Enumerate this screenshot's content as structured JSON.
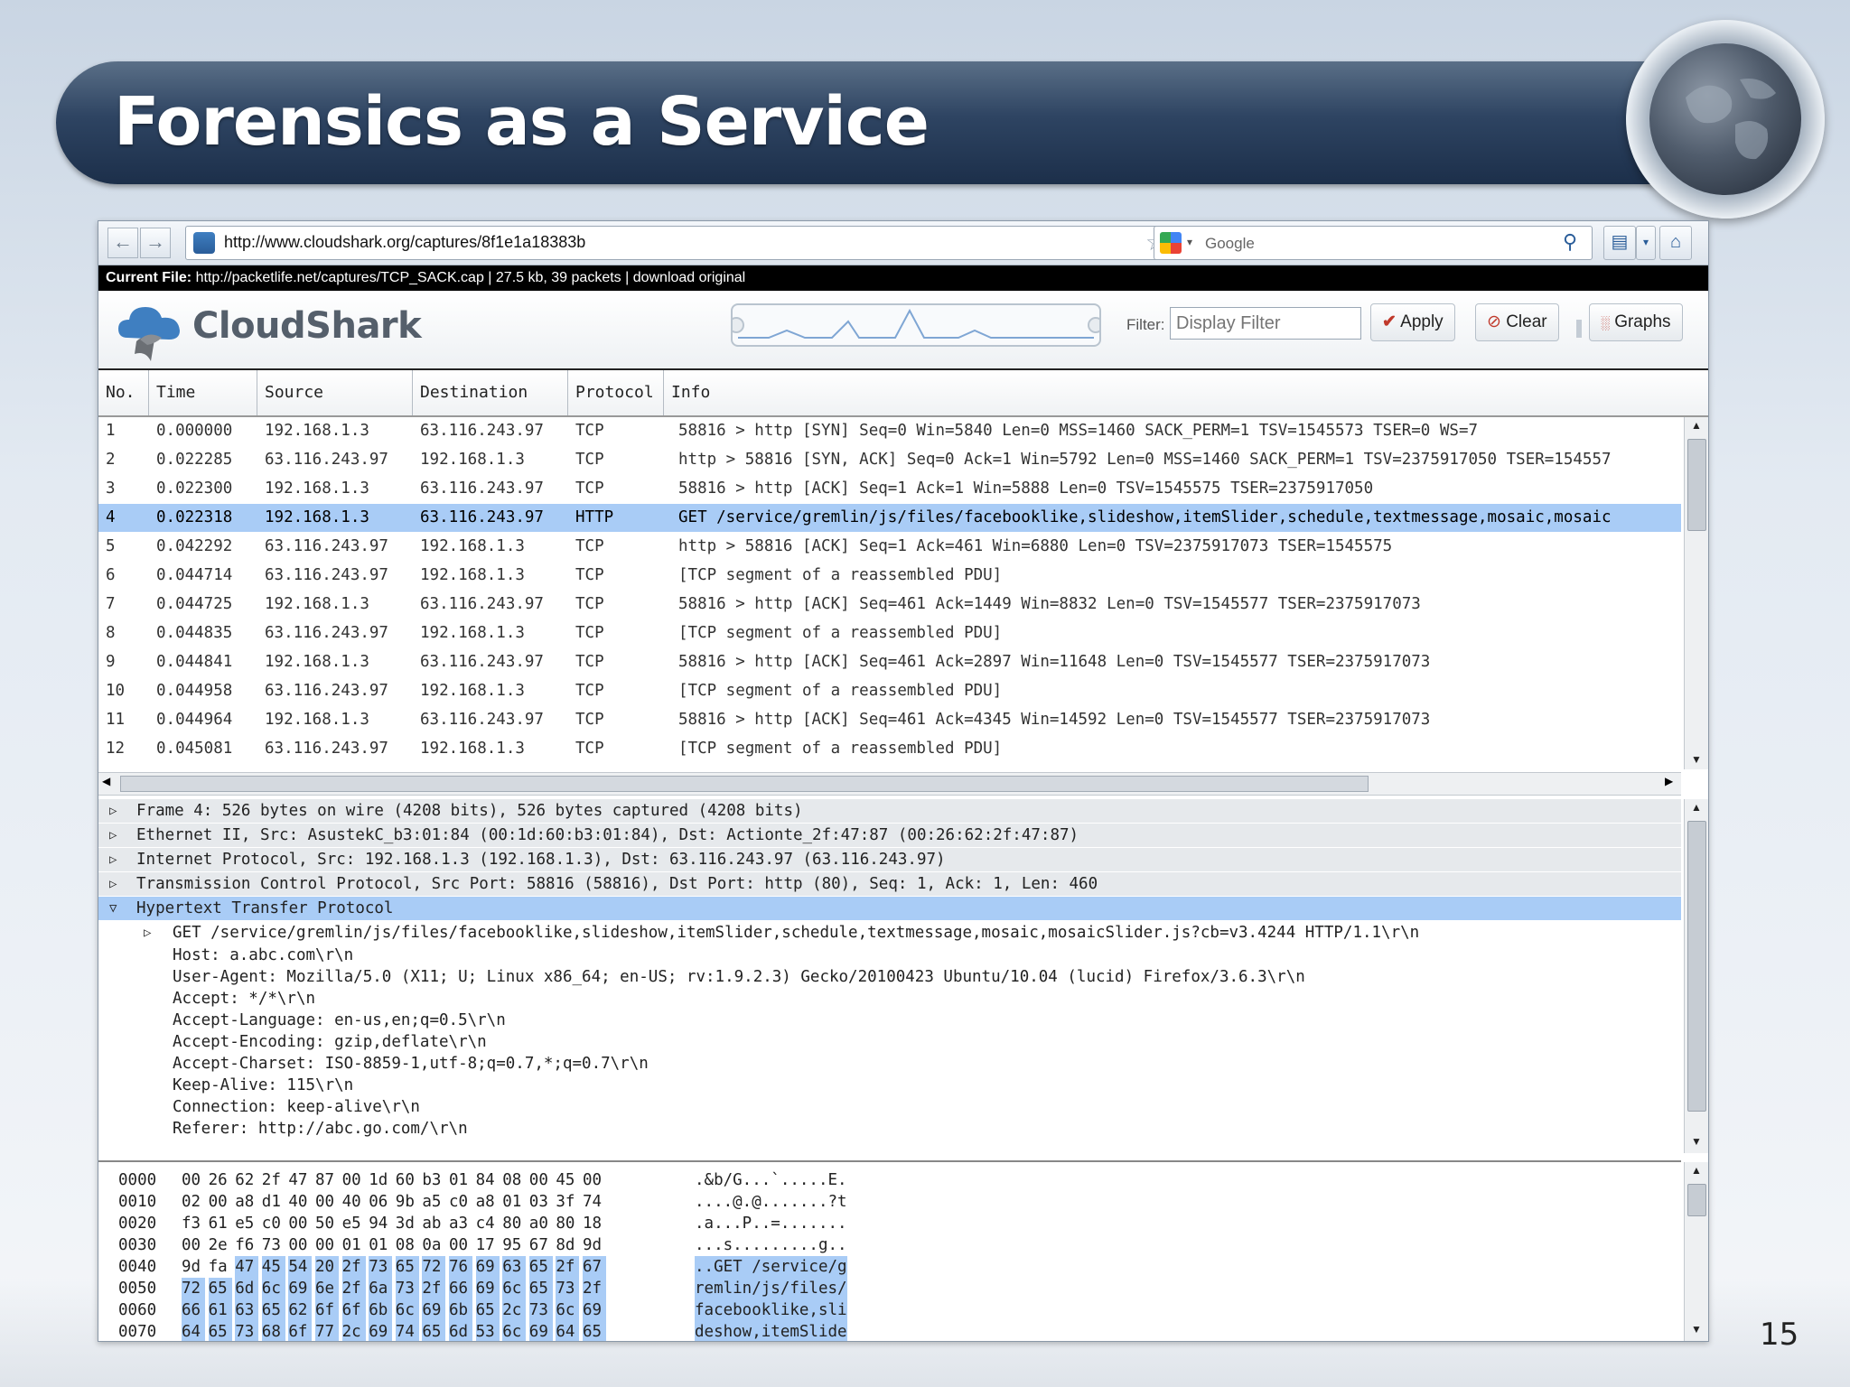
{
  "slide": {
    "title": "Forensics as a Service",
    "page_number": "15"
  },
  "browser": {
    "url": "http://www.cloudshark.org/captures/8f1e1a18383b",
    "search_placeholder": "Google",
    "current_file": {
      "label": "Current File:",
      "text": "http://packetlife.net/captures/TCP_SACK.cap | 27.5 kb, 39 packets | download original"
    }
  },
  "cloudshark": {
    "brand": "CloudShark",
    "filter_label": "Filter:",
    "filter_placeholder": "Display Filter",
    "apply_label": "Apply",
    "clear_label": "Clear",
    "graphs_label": "Graphs",
    "accent_color": "#3f7fc1",
    "selection_color": "#a9ccf6"
  },
  "packet_list": {
    "columns": [
      "No.",
      "Time",
      "Source",
      "Destination",
      "Protocol",
      "Info"
    ],
    "rows": [
      {
        "no": "1",
        "time": "0.000000",
        "src": "192.168.1.3",
        "dst": "63.116.243.97",
        "proto": "TCP",
        "info": "58816 > http [SYN] Seq=0 Win=5840 Len=0 MSS=1460 SACK_PERM=1 TSV=1545573 TSER=0 WS=7",
        "selected": false
      },
      {
        "no": "2",
        "time": "0.022285",
        "src": "63.116.243.97",
        "dst": "192.168.1.3",
        "proto": "TCP",
        "info": "http > 58816 [SYN, ACK] Seq=0 Ack=1 Win=5792 Len=0 MSS=1460 SACK_PERM=1 TSV=2375917050 TSER=154557",
        "selected": false
      },
      {
        "no": "3",
        "time": "0.022300",
        "src": "192.168.1.3",
        "dst": "63.116.243.97",
        "proto": "TCP",
        "info": "58816 > http [ACK] Seq=1 Ack=1 Win=5888 Len=0 TSV=1545575 TSER=2375917050",
        "selected": false
      },
      {
        "no": "4",
        "time": "0.022318",
        "src": "192.168.1.3",
        "dst": "63.116.243.97",
        "proto": "HTTP",
        "info": "GET /service/gremlin/js/files/facebooklike,slideshow,itemSlider,schedule,textmessage,mosaic,mosaic",
        "selected": true
      },
      {
        "no": "5",
        "time": "0.042292",
        "src": "63.116.243.97",
        "dst": "192.168.1.3",
        "proto": "TCP",
        "info": "http > 58816 [ACK] Seq=1 Ack=461 Win=6880 Len=0 TSV=2375917073 TSER=1545575",
        "selected": false
      },
      {
        "no": "6",
        "time": "0.044714",
        "src": "63.116.243.97",
        "dst": "192.168.1.3",
        "proto": "TCP",
        "info": "[TCP segment of a reassembled PDU]",
        "selected": false
      },
      {
        "no": "7",
        "time": "0.044725",
        "src": "192.168.1.3",
        "dst": "63.116.243.97",
        "proto": "TCP",
        "info": "58816 > http [ACK] Seq=461 Ack=1449 Win=8832 Len=0 TSV=1545577 TSER=2375917073",
        "selected": false
      },
      {
        "no": "8",
        "time": "0.044835",
        "src": "63.116.243.97",
        "dst": "192.168.1.3",
        "proto": "TCP",
        "info": "[TCP segment of a reassembled PDU]",
        "selected": false
      },
      {
        "no": "9",
        "time": "0.044841",
        "src": "192.168.1.3",
        "dst": "63.116.243.97",
        "proto": "TCP",
        "info": "58816 > http [ACK] Seq=461 Ack=2897 Win=11648 Len=0 TSV=1545577 TSER=2375917073",
        "selected": false
      },
      {
        "no": "10",
        "time": "0.044958",
        "src": "63.116.243.97",
        "dst": "192.168.1.3",
        "proto": "TCP",
        "info": "[TCP segment of a reassembled PDU]",
        "selected": false
      },
      {
        "no": "11",
        "time": "0.044964",
        "src": "192.168.1.3",
        "dst": "63.116.243.97",
        "proto": "TCP",
        "info": "58816 > http [ACK] Seq=461 Ack=4345 Win=14592 Len=0 TSV=1545577 TSER=2375917073",
        "selected": false
      },
      {
        "no": "12",
        "time": "0.045081",
        "src": "63.116.243.97",
        "dst": "192.168.1.3",
        "proto": "TCP",
        "info": "[TCP segment of a reassembled PDU]",
        "selected": false
      }
    ]
  },
  "details": [
    {
      "kind": "collapsed",
      "text": "Frame 4: 526 bytes on wire (4208 bits), 526 bytes captured (4208 bits)"
    },
    {
      "kind": "collapsed",
      "text": "Ethernet II, Src: AsustekC_b3:01:84 (00:1d:60:b3:01:84), Dst: Actionte_2f:47:87 (00:26:62:2f:47:87)"
    },
    {
      "kind": "collapsed",
      "text": "Internet Protocol, Src: 192.168.1.3 (192.168.1.3), Dst: 63.116.243.97 (63.116.243.97)"
    },
    {
      "kind": "collapsed",
      "text": "Transmission Control Protocol, Src Port: 58816 (58816), Dst Port: http (80), Seq: 1, Ack: 1, Len: 460"
    },
    {
      "kind": "expanded",
      "text": "Hypertext Transfer Protocol"
    },
    {
      "kind": "child-collapsed",
      "text": "GET /service/gremlin/js/files/facebooklike,slideshow,itemSlider,schedule,textmessage,mosaic,mosaicSlider.js?cb=v3.4244 HTTP/1.1\\r\\n"
    },
    {
      "kind": "child",
      "text": "Host: a.abc.com\\r\\n"
    },
    {
      "kind": "child",
      "text": "User-Agent: Mozilla/5.0 (X11; U; Linux x86_64; en-US; rv:1.9.2.3) Gecko/20100423 Ubuntu/10.04 (lucid) Firefox/3.6.3\\r\\n"
    },
    {
      "kind": "child",
      "text": "Accept: */*\\r\\n"
    },
    {
      "kind": "child",
      "text": "Accept-Language: en-us,en;q=0.5\\r\\n"
    },
    {
      "kind": "child",
      "text": "Accept-Encoding: gzip,deflate\\r\\n"
    },
    {
      "kind": "child",
      "text": "Accept-Charset: ISO-8859-1,utf-8;q=0.7,*;q=0.7\\r\\n"
    },
    {
      "kind": "child",
      "text": "Keep-Alive: 115\\r\\n"
    },
    {
      "kind": "child",
      "text": "Connection: keep-alive\\r\\n"
    },
    {
      "kind": "child",
      "text": "Referer: http://abc.go.com/\\r\\n"
    }
  ],
  "hex": [
    {
      "offset": "0000",
      "bytes": [
        "00",
        "26",
        "62",
        "2f",
        "47",
        "87",
        "00",
        "1d",
        "60",
        "b3",
        "01",
        "84",
        "08",
        "00",
        "45",
        "00"
      ],
      "sel_from": 16,
      "ascii": ".&b/G...`.....E.",
      "ascii_sel": false
    },
    {
      "offset": "0010",
      "bytes": [
        "02",
        "00",
        "a8",
        "d1",
        "40",
        "00",
        "40",
        "06",
        "9b",
        "a5",
        "c0",
        "a8",
        "01",
        "03",
        "3f",
        "74"
      ],
      "sel_from": 16,
      "ascii": "....@.@.......?t",
      "ascii_sel": false
    },
    {
      "offset": "0020",
      "bytes": [
        "f3",
        "61",
        "e5",
        "c0",
        "00",
        "50",
        "e5",
        "94",
        "3d",
        "ab",
        "a3",
        "c4",
        "80",
        "a0",
        "80",
        "18"
      ],
      "sel_from": 16,
      "ascii": ".a...P..=.......",
      "ascii_sel": false
    },
    {
      "offset": "0030",
      "bytes": [
        "00",
        "2e",
        "f6",
        "73",
        "00",
        "00",
        "01",
        "01",
        "08",
        "0a",
        "00",
        "17",
        "95",
        "67",
        "8d",
        "9d"
      ],
      "sel_from": 16,
      "ascii": "...s.........g..",
      "ascii_sel": false
    },
    {
      "offset": "0040",
      "bytes": [
        "9d",
        "fa",
        "47",
        "45",
        "54",
        "20",
        "2f",
        "73",
        "65",
        "72",
        "76",
        "69",
        "63",
        "65",
        "2f",
        "67"
      ],
      "sel_from": 2,
      "ascii": "..GET /service/g",
      "ascii_sel": true
    },
    {
      "offset": "0050",
      "bytes": [
        "72",
        "65",
        "6d",
        "6c",
        "69",
        "6e",
        "2f",
        "6a",
        "73",
        "2f",
        "66",
        "69",
        "6c",
        "65",
        "73",
        "2f"
      ],
      "sel_from": 0,
      "ascii": "remlin/js/files/",
      "ascii_sel": true
    },
    {
      "offset": "0060",
      "bytes": [
        "66",
        "61",
        "63",
        "65",
        "62",
        "6f",
        "6f",
        "6b",
        "6c",
        "69",
        "6b",
        "65",
        "2c",
        "73",
        "6c",
        "69"
      ],
      "sel_from": 0,
      "ascii": "facebooklike,sli",
      "ascii_sel": true
    },
    {
      "offset": "0070",
      "bytes": [
        "64",
        "65",
        "73",
        "68",
        "6f",
        "77",
        "2c",
        "69",
        "74",
        "65",
        "6d",
        "53",
        "6c",
        "69",
        "64",
        "65"
      ],
      "sel_from": 0,
      "ascii": "deshow,itemSlide",
      "ascii_sel": true
    }
  ]
}
